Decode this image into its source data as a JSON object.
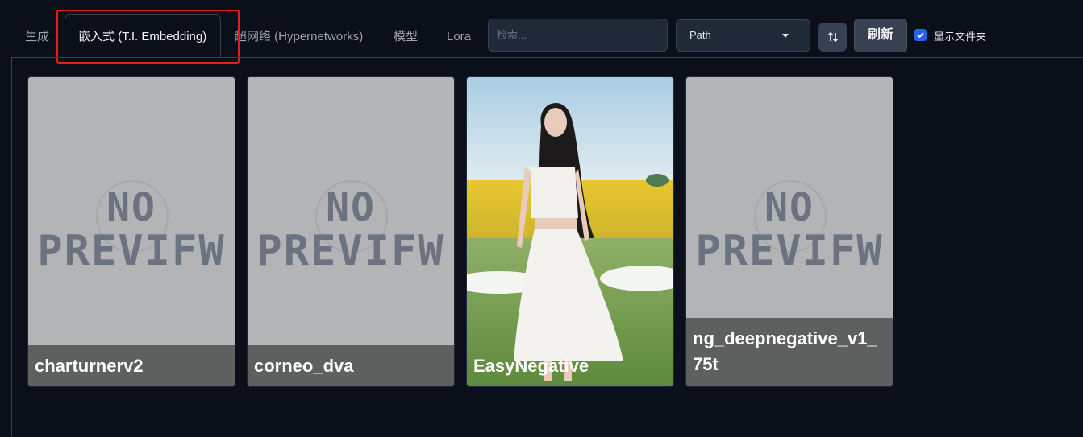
{
  "tabs": [
    {
      "label": "生成"
    },
    {
      "label": "嵌入式 (T.I. Embedding)"
    },
    {
      "label": "超网络 (Hypernetworks)"
    },
    {
      "label": "模型"
    },
    {
      "label": "Lora"
    }
  ],
  "search": {
    "placeholder": "检索...",
    "value": ""
  },
  "sort_select": {
    "value": "Path"
  },
  "refresh": {
    "label": "刷新"
  },
  "show_dirs": {
    "label": "显示文件夹",
    "checked": true
  },
  "cards": [
    {
      "name": "charturnerv2",
      "preview": "no-preview",
      "preview_text": [
        "NO",
        "PREVIFW"
      ]
    },
    {
      "name": "corneo_dva",
      "preview": "no-preview",
      "preview_text": [
        "NO",
        "PREVIFW"
      ]
    },
    {
      "name": "EasyNegative",
      "preview": "photo-woman-white-dress-flower-field"
    },
    {
      "name": "ng_deepnegative_v1_75t",
      "preview": "no-preview",
      "preview_text": [
        "NO",
        "PREVIFW"
      ]
    }
  ],
  "colors": {
    "background": "#0b0f19",
    "highlight": "#e11d1d",
    "accent": "#2563eb"
  }
}
